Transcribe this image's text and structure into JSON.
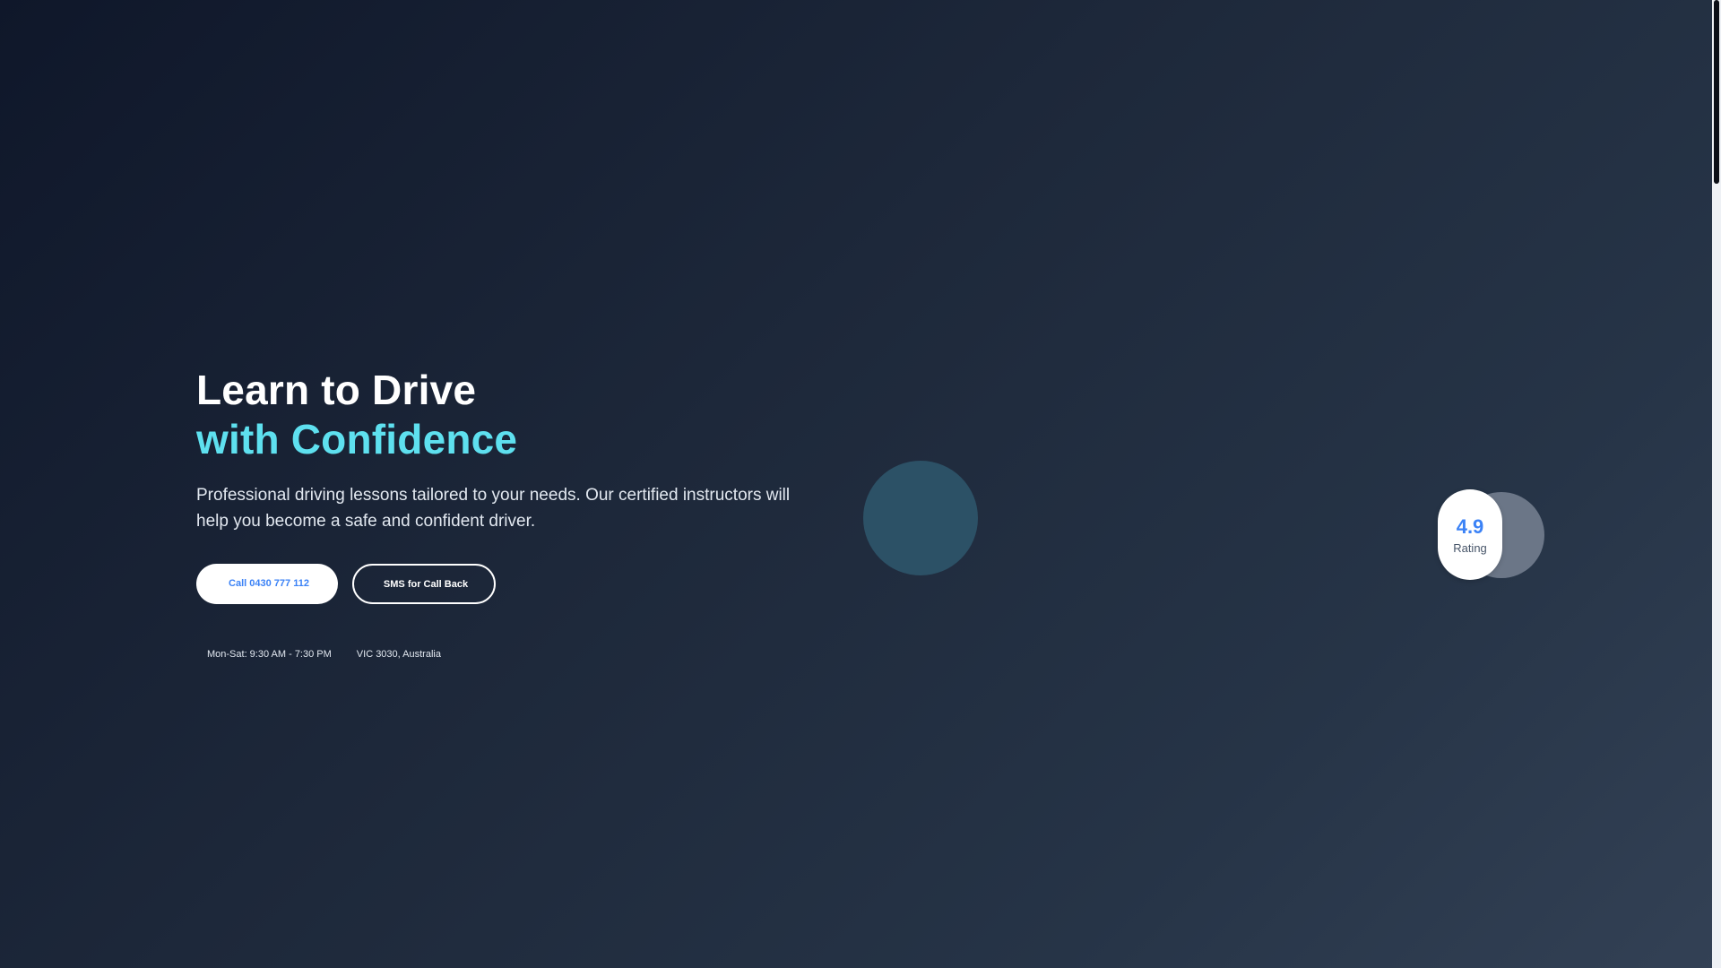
{
  "hero": {
    "title_line1": "Learn to Drive",
    "title_line2": "with Confidence",
    "subtitle": "Professional driving lessons tailored to your needs. Our certified instructors will help you become a safe and confident driver.",
    "call_button": "Call 0430 777 112",
    "sms_button": "SMS for Call Back",
    "hours": "Mon-Sat: 9:30 AM - 7:30 PM",
    "location": "VIC 3030, Australia"
  },
  "rating": {
    "value": "4.9",
    "label": "Rating"
  },
  "colors": {
    "accent": "#5ee0ef",
    "primary_blue": "#3b82f6",
    "background_start": "#0f172a",
    "background_end": "#334155"
  }
}
